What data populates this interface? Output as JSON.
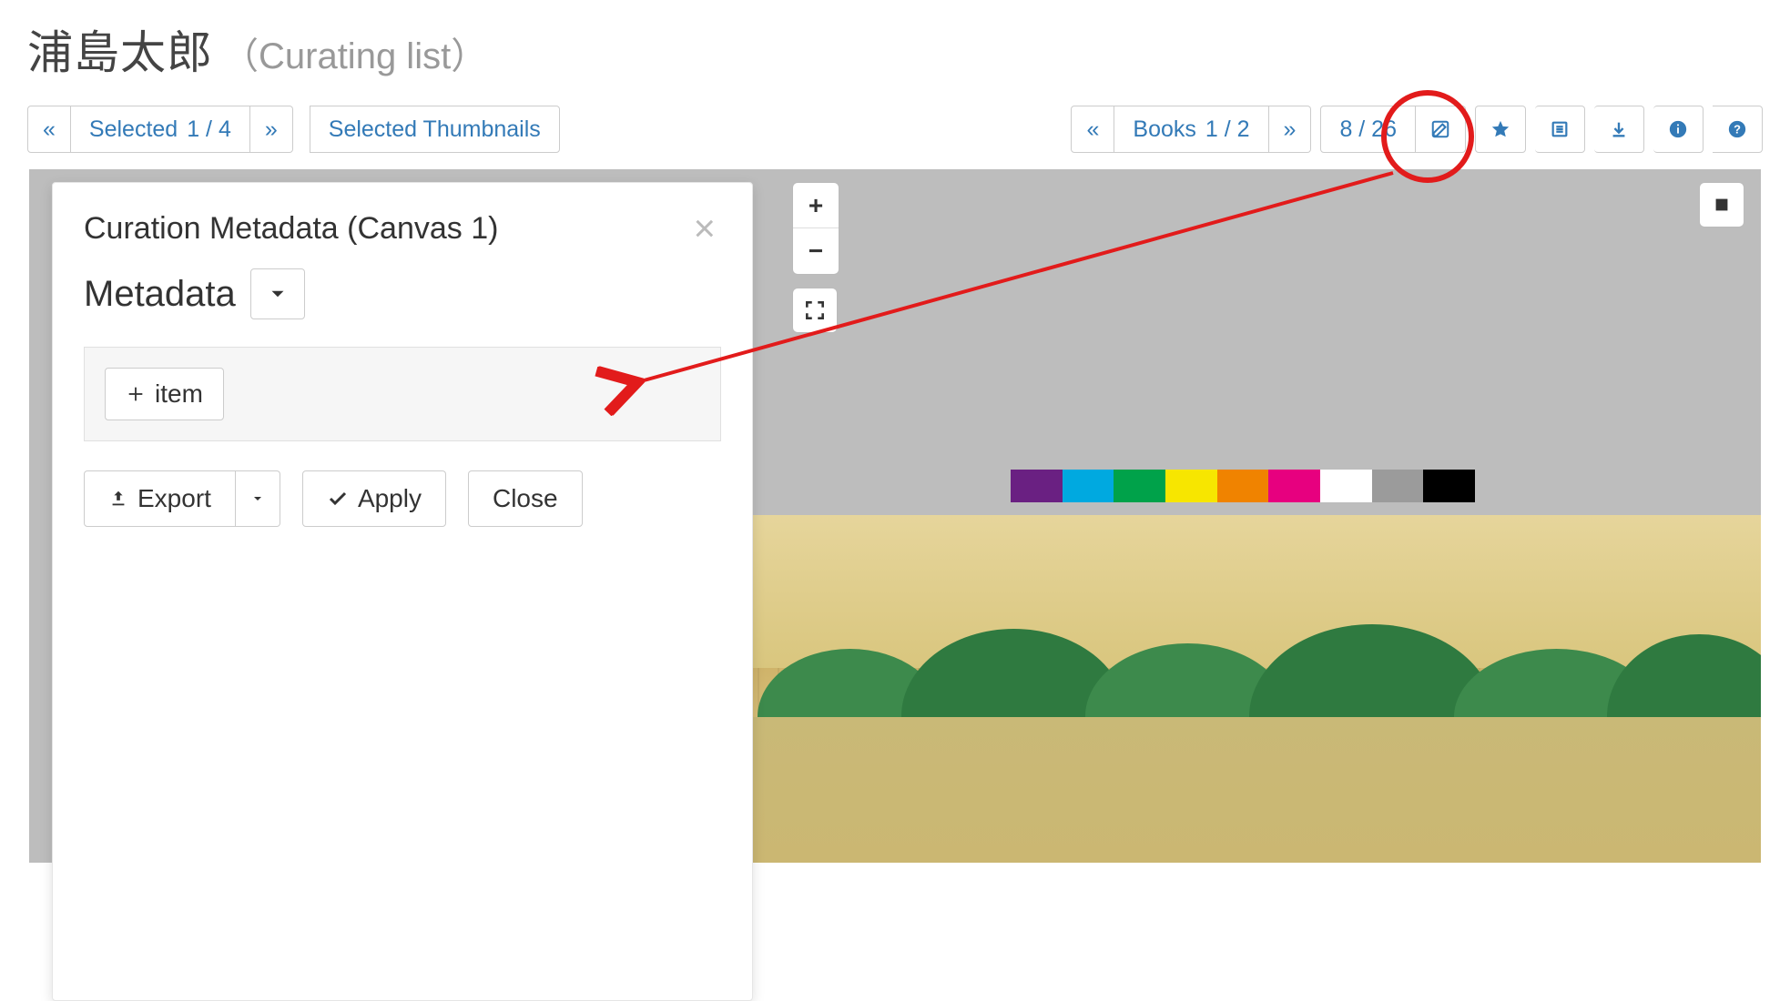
{
  "title": {
    "main": "浦島太郎",
    "sub": "（Curating list）"
  },
  "toolbar_left": {
    "prev": "«",
    "selected_label": "Selected",
    "selected_count": "1 / 4",
    "next": "»",
    "thumbnails": "Selected Thumbnails"
  },
  "toolbar_right": {
    "prev": "«",
    "books_label": "Books",
    "books_count": "1 / 2",
    "next": "»",
    "page": "8 / 26"
  },
  "panel": {
    "title": "Curation Metadata (Canvas 1)",
    "section": "Metadata",
    "add_item": "item",
    "export": "Export",
    "apply": "Apply",
    "close": "Close"
  },
  "icons": {
    "edit": "edit-icon",
    "star": "star-icon",
    "list": "list-icon",
    "download": "download-icon",
    "info": "info-icon",
    "help": "help-icon",
    "plus": "plus-icon",
    "check": "check-icon",
    "export": "export-icon",
    "caret": "caret-down-icon",
    "fullscreen": "fullscreen-icon",
    "stop": "stop-icon"
  },
  "viewer": {
    "zoom_in": "+",
    "zoom_out": "−"
  }
}
